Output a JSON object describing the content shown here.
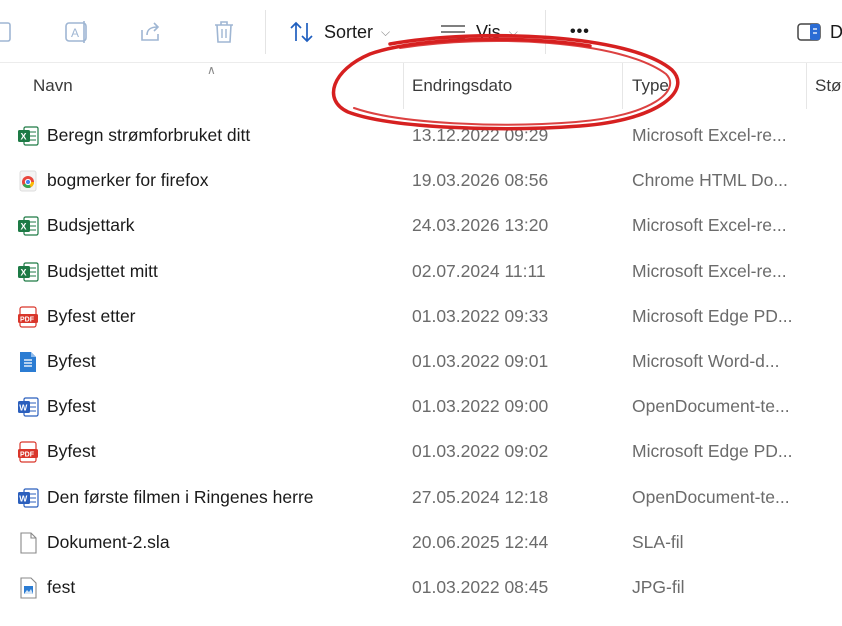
{
  "toolbar": {
    "sort_label": "Sorter",
    "view_label": "Vis",
    "more_label": "•••",
    "details_label": "D"
  },
  "columns": {
    "name": "Navn",
    "date": "Endringsdato",
    "type": "Type",
    "size": "Stø"
  },
  "files": [
    {
      "name": "Beregn strømforbruket ditt",
      "date": "13.12.2022 09:29",
      "type": "Microsoft Excel-re...",
      "icon": "excel-icon"
    },
    {
      "name": "bogmerker for firefox",
      "date": "19.03.2026 08:56",
      "type": "Chrome HTML Do...",
      "icon": "chrome-icon"
    },
    {
      "name": "Budsjettark",
      "date": "24.03.2026 13:20",
      "type": "Microsoft Excel-re...",
      "icon": "excel-icon"
    },
    {
      "name": "Budsjettet mitt",
      "date": "02.07.2024 11:11",
      "type": "Microsoft Excel-re...",
      "icon": "excel-icon"
    },
    {
      "name": "Byfest etter",
      "date": "01.03.2022 09:33",
      "type": "Microsoft Edge PD...",
      "icon": "pdf-icon"
    },
    {
      "name": "Byfest",
      "date": "01.03.2022 09:01",
      "type": "Microsoft Word-d...",
      "icon": "word-doc-icon"
    },
    {
      "name": "Byfest",
      "date": "01.03.2022 09:00",
      "type": "OpenDocument-te...",
      "icon": "word-icon"
    },
    {
      "name": "Byfest",
      "date": "01.03.2022 09:02",
      "type": "Microsoft Edge PD...",
      "icon": "pdf-icon"
    },
    {
      "name": "Den første filmen i Ringenes herre",
      "date": "27.05.2024 12:18",
      "type": "OpenDocument-te...",
      "icon": "word-icon"
    },
    {
      "name": "Dokument-2.sla",
      "date": "20.06.2025 12:44",
      "type": "SLA-fil",
      "icon": "blank-file-icon"
    },
    {
      "name": "fest",
      "date": "01.03.2022 08:45",
      "type": "JPG-fil",
      "icon": "image-file-icon"
    }
  ],
  "colors": {
    "annotation": "#d62020",
    "excel": "#1d7a45",
    "word": "#2b5fbd",
    "pdf": "#d9362b"
  }
}
